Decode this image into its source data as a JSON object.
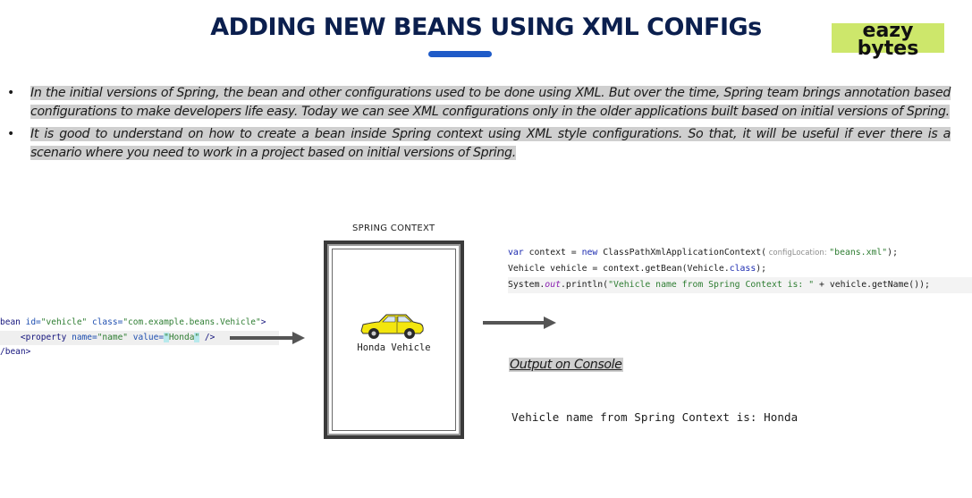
{
  "title": "ADDING NEW BEANS USING XML CONFIGs",
  "logo": {
    "line1": "eazy",
    "line2": "bytes",
    "color": "#cde76b"
  },
  "bullets": [
    "In the initial versions of Spring, the bean and other configurations used to be done using XML. But over the time, Spring team brings annotation based configurations to make developers life easy. Today we can see XML configurations only in the older applications built based on initial versions of Spring.",
    "It is good to understand on how to create a bean inside Spring context using XML style configurations. So that, it will be useful if ever there is a scenario where you need to work in a project based on initial versions of Spring."
  ],
  "bullet_symbol": "•",
  "xml_snippet": {
    "l1_tag_open": "bean ",
    "l1_attr_id": "id=",
    "l1_val_id": "\"vehicle\"",
    "l1_attr_class": " class=",
    "l1_val_class": "\"com.example.beans.Vehicle\"",
    "l1_tag_close": ">",
    "l2_indent": "    ",
    "l2_tag_open": "<property ",
    "l2_attr_name": "name=",
    "l2_val_name": "\"name\"",
    "l2_attr_value": " value=",
    "l2_val_q1": "\"",
    "l2_val_value": "Honda",
    "l2_val_q2": "\"",
    "l2_tag_close": " />",
    "l3": "/bean>"
  },
  "spring_context": {
    "label": "SPRING CONTEXT",
    "car_label": "Honda Vehicle",
    "car_color": "#f3e60e"
  },
  "java_code": {
    "l1_kw1": "var",
    "l1_a": " context = ",
    "l1_kw2": "new",
    "l1_b": " ClassPathXmlApplicationContext(",
    "l1_hint": " configLocation: ",
    "l1_str": "\"beans.xml\"",
    "l1_c": ");",
    "l2": "Vehicle vehicle = context.getBean(Vehicle.",
    "l2_kw": "class",
    "l2_c": ");",
    "l3_a": "System.",
    "l3_static": "out",
    "l3_b": ".println(",
    "l3_str": "\"Vehicle name from Spring Context is: \"",
    "l3_c": " + vehicle.getName());"
  },
  "output": {
    "heading": "Output on Console",
    "console_text": "Vehicle name from Spring Context is: Honda"
  }
}
